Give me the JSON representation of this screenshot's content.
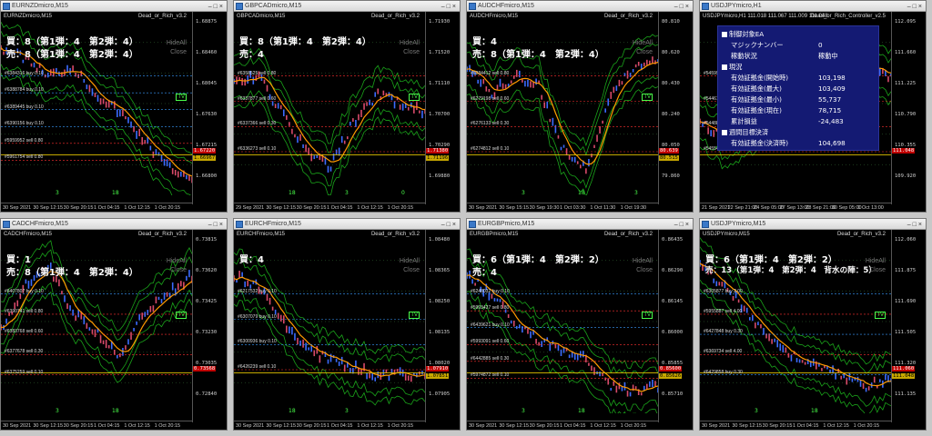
{
  "windows": [
    {
      "title": "EURNZDmicro,M15",
      "symbol_label": "EURNZDmicro,M15",
      "ea_label": "Dead_or_Rich_v3.2",
      "position_lines": [
        "買：8（第1弾：4　第2弾：4）",
        "売：8（第1弾：4　第2弾：4）"
      ],
      "hide_labels": [
        "HideAll",
        "Close"
      ],
      "tv_label": "TV",
      "prices": [
        "1.68875",
        "1.68460",
        "1.68045",
        "1.67630",
        "1.67215",
        "1.66800"
      ],
      "current_price": "1.67220",
      "current_price2": "1.66967",
      "times": [
        "30 Sep 2021",
        "30 Sep 12:15",
        "30 Sep 20:15",
        "1 Oct 04:15",
        "1 Oct 12:15",
        "1 Oct 20:15"
      ],
      "orders": [
        "#6384316 buy 0.10",
        "#6388784 buy 0.10",
        "#6389445 buy 0.10",
        "#6390156 buy 0.10",
        "#5959952 sell 0.80",
        "#5961754 sell 0.80"
      ],
      "x_marks": [
        "3",
        "18"
      ]
    },
    {
      "title": "GBPCADmicro,M15",
      "symbol_label": "GBPCADmicro,M15",
      "ea_label": "Dead_or_Rich_v3.2",
      "position_lines": [
        "買：8（第1弾：4　第2弾：4）",
        "売：4"
      ],
      "hide_labels": [
        "HideAll",
        "Close"
      ],
      "tv_label": "TV",
      "prices": [
        "1.71930",
        "1.71520",
        "1.71110",
        "1.70700",
        "1.70290",
        "1.69880"
      ],
      "current_price": "1.71380",
      "current_price2": "1.71196",
      "times": [
        "29 Sep 2021",
        "30 Sep 12:15",
        "30 Sep 20:15",
        "1 Oct 04:15",
        "1 Oct 12:15",
        "1 Oct 20:15"
      ],
      "orders": [
        "#6358525 sell 0.80",
        "#6337877 sell 0.60",
        "#6337366 sell 0.30",
        "#6336273 sell 0.10"
      ],
      "x_marks": [
        "18",
        "3",
        "0"
      ]
    },
    {
      "title": "AUDCHFmicro,M15",
      "symbol_label": "AUDCHFmicro,M15",
      "ea_label": "Dead_or_Rich_v3.2",
      "position_lines": [
        "買：4",
        "売：8（第1弾：4　第2弾：4）"
      ],
      "hide_labels": [
        "HideAll",
        "Close"
      ],
      "tv_label": "TV",
      "prices": [
        "80.810",
        "80.620",
        "80.430",
        "80.240",
        "80.050",
        "79.860"
      ],
      "current_price": "80.639",
      "current_price2": "80.515",
      "times": [
        "30 Sep 2021",
        "30 Sep 15:15",
        "30 Sep 19:30",
        "1 Oct 03:30",
        "1 Oct 11:30",
        "1 Oct 19:30"
      ],
      "orders": [
        "#6284412 sell 0.80",
        "#6279198 sell 0.60",
        "#6276133 sell 0.30",
        "#6274812 sell 0.10"
      ],
      "x_marks": [
        "3",
        "18",
        "3"
      ]
    },
    {
      "title": "USDJPYmicro,H1",
      "symbol_label": "USDJPYmicro,H1  111.018 111.067 111.009 111.048",
      "ea_label": "Dead_or_Rich_Controller_v2.5",
      "position_lines": [],
      "hide_labels": [],
      "tv_label": "",
      "prices": [
        "112.095",
        "111.660",
        "111.225",
        "110.790",
        "110.355",
        "109.920"
      ],
      "current_price": "111.048",
      "current_price2": "",
      "times": [
        "21 Sep 2021",
        "22 Sep 21:00",
        "24 Sep 05:00",
        "27 Sep 13:00",
        "28 Sep 21:00",
        "30 Sep 05:00",
        "1 Oct 13:00"
      ],
      "orders": [
        "#5459966 sell 0.80",
        "#5446131 sell 0.60",
        "#5448817 sell 0.30",
        "#5455487 sell 0.10"
      ],
      "x_marks": []
    },
    {
      "title": "CADCHFmicro,M15",
      "symbol_label": "CADCHFmicro,M15",
      "ea_label": "Dead_or_Rich_v3.2",
      "position_lines": [
        "買：1",
        "売：8（第1弾：4　第2弾：4）"
      ],
      "hide_labels": [
        "HideAll",
        "Close"
      ],
      "tv_label": "TV",
      "prices": [
        "0.73815",
        "0.73620",
        "0.73425",
        "0.73230",
        "0.73035",
        "0.72840"
      ],
      "current_price": "0.73568",
      "current_price2": "",
      "times": [
        "30 Sep 2021",
        "30 Sep 12:15",
        "30 Sep 20:15",
        "1 Oct 04:15",
        "1 Oct 12:15",
        "1 Oct 20:15"
      ],
      "orders": [
        "#6407807 buy 0.10",
        "#6390741 sell 0.80",
        "#6383768 sell 0.60",
        "#6377678 sell 0.30",
        "#6375259 sell 0.10"
      ],
      "x_marks": [
        "3",
        "18"
      ]
    },
    {
      "title": "EURCHFmicro,M15",
      "symbol_label": "EURCHFmicro,M15",
      "ea_label": "Dead_or_Rich_v3.2",
      "position_lines": [
        "買：4"
      ],
      "hide_labels": [
        "HideAll",
        "Close"
      ],
      "tv_label": "TV",
      "prices": [
        "1.08480",
        "1.08365",
        "1.08250",
        "1.08135",
        "1.08020",
        "1.07905"
      ],
      "current_price": "1.07910",
      "current_price2": "1.07851",
      "times": [
        "30 Sep 2021",
        "30 Sep 12:15",
        "30 Sep 20:15",
        "1 Oct 04:15",
        "1 Oct 12:15",
        "1 Oct 20:15"
      ],
      "orders": [
        "#6217532 buy 0.10",
        "#6307079 buy 0.10",
        "#6300936 buy 0.10",
        "#6426239 sell 0.10"
      ],
      "x_marks": [
        "18",
        "3"
      ]
    },
    {
      "title": "EURGBPmicro,M15",
      "symbol_label": "EURGBPmicro,M15",
      "ea_label": "Dead_or_Rich_v3.2",
      "position_lines": [
        "買：6（第1弾：4　第2弾：2）",
        "売：4"
      ],
      "hide_labels": [
        "HideAll",
        "Close"
      ],
      "tv_label": "TV",
      "prices": [
        "0.86435",
        "0.86290",
        "0.86145",
        "0.86000",
        "0.85855",
        "0.85710"
      ],
      "current_price": "0.85600",
      "current_price2": "0.85626",
      "times": [
        "30 Sep 2021",
        "30 Sep 12:15",
        "30 Sep 20:15",
        "1 Oct 04:15",
        "1 Oct 12:15",
        "1 Oct 20:15"
      ],
      "orders": [
        "#6248032 buy 0.10",
        "#5993427 sell 0.80",
        "#6439621 buy 0.10",
        "#5993091 sell 0.60",
        "#6442885 sell 0.30",
        "#5974872 sell 0.10"
      ],
      "x_marks": [
        "3",
        "18"
      ]
    },
    {
      "title": "USDJPYmicro,M15",
      "symbol_label": "USDJPYmicro,M15",
      "ea_label": "Dead_or_Rich_v3.2",
      "position_lines": [
        "買：6（第1弾：4　第2弾：2）",
        "売：13（第1弾：4　第2弾：4　背水の陣：5）"
      ],
      "hide_labels": [
        "HideAll",
        "Close"
      ],
      "tv_label": "TV",
      "prices": [
        "112.060",
        "111.875",
        "111.690",
        "111.505",
        "111.320",
        "111.135"
      ],
      "current_price": "111.060",
      "current_price2": "111.048",
      "times": [
        "30 Sep 2021",
        "30 Sep 12:15",
        "30 Sep 20:15",
        "1 Oct 04:15",
        "1 Oct 12:15",
        "1 Oct 20:15"
      ],
      "orders": [
        "#6305877 buy 2.00",
        "#5955887 sell 4.00",
        "#6427848 buy 0.30",
        "#6369734 sell 4.00",
        "#6429858 buy 0.30"
      ],
      "x_marks": [
        "3",
        "18"
      ]
    }
  ],
  "controller_panel": {
    "rows": [
      {
        "kind": "head",
        "label": "制御対象EA"
      },
      {
        "kind": "kv",
        "label": "マジックナンバー",
        "value": "0"
      },
      {
        "kind": "kv",
        "label": "稼動状況",
        "value": "稼動中"
      },
      {
        "kind": "head",
        "label": "現況"
      },
      {
        "kind": "kv",
        "label": "有効証拠金(開始時)",
        "value": "103,198"
      },
      {
        "kind": "kv",
        "label": "有効証拠金(最大)",
        "value": "103,409"
      },
      {
        "kind": "kv",
        "label": "有効証拠金(最小)",
        "value": "55,737"
      },
      {
        "kind": "kv",
        "label": "有効証拠金(現在)",
        "value": "78,715"
      },
      {
        "kind": "kv",
        "label": "累計損益",
        "value": "-24,483"
      },
      {
        "kind": "head",
        "label": "週間目標決済"
      },
      {
        "kind": "kv",
        "label": "有効証拠金(決済時)",
        "value": "104,698"
      }
    ]
  },
  "colors": {
    "ma_orange": "#ff9a00",
    "bollinger_green": "#1aa31a",
    "buy_line": "#3a9cff",
    "sell_line": "#ff3030",
    "panel_bg": "#141a73"
  }
}
